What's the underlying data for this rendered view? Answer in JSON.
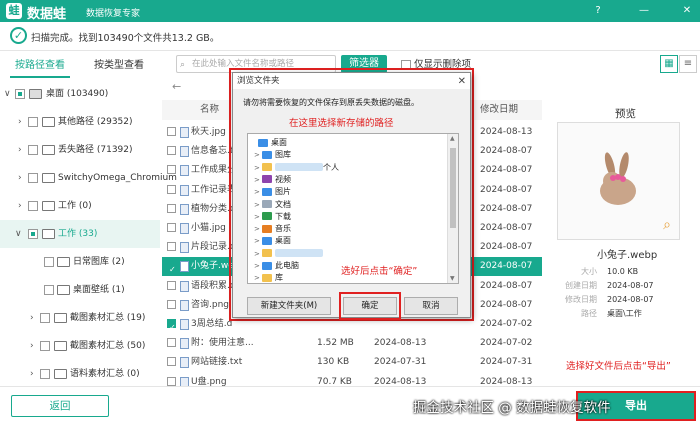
{
  "app": {
    "name": "数据蛙",
    "subtitle": "数据恢复专家",
    "brand_color": "#18a98e",
    "window_controls": [
      "?",
      "—",
      "✕"
    ]
  },
  "scan": {
    "status_text": "扫描完成。找到103490个文件共13.2 GB。"
  },
  "tabs": [
    {
      "label": "按路径查看",
      "active": true
    },
    {
      "label": "按类型查看",
      "active": false
    }
  ],
  "search": {
    "placeholder": "在此处输入文件名称或路径"
  },
  "filter_button": "筛选器",
  "only_deleted": "仅显示删除项",
  "tree": [
    {
      "label": "桌面 (103490)",
      "checkbox": "partial",
      "expanded": true
    },
    {
      "label": "其他路径 (29352)",
      "checkbox": "off"
    },
    {
      "label": "丢失路径 (71392)",
      "checkbox": "off"
    },
    {
      "label": "SwitchyOmega_Chromium",
      "checkbox": "off"
    },
    {
      "label": "工作 (0)",
      "checkbox": "off"
    },
    {
      "label": "工作 (33)",
      "checkbox": "partial",
      "expanded": true,
      "selected": true
    },
    {
      "label": "日常图库 (2)",
      "checkbox": "off"
    },
    {
      "label": "桌面壁纸 (1)",
      "checkbox": "off"
    },
    {
      "label": "截图素材汇总 (19)",
      "checkbox": "off"
    },
    {
      "label": "截图素材汇总 (50)",
      "checkbox": "off"
    },
    {
      "label": "语料素材汇总 (0)",
      "checkbox": "off"
    }
  ],
  "list": {
    "headers": {
      "name": "名称",
      "modified": "修改日期"
    },
    "rows": [
      {
        "name": "秋天.jpg",
        "size": "",
        "created": "",
        "modified": "2024-08-13",
        "checked": false,
        "selected": false
      },
      {
        "name": "信息备忘.t",
        "size": "",
        "created": "",
        "modified": "2024-08-07",
        "checked": false,
        "selected": false
      },
      {
        "name": "工作成果分",
        "size": "",
        "created": "",
        "modified": "2024-08-07",
        "checked": false,
        "selected": false
      },
      {
        "name": "工作记录表",
        "size": "",
        "created": "",
        "modified": "2024-08-07",
        "checked": false,
        "selected": false
      },
      {
        "name": "植物分类.d",
        "size": "",
        "created": "",
        "modified": "2024-08-07",
        "checked": false,
        "selected": false
      },
      {
        "name": "小猫.jpg",
        "size": "",
        "created": "",
        "modified": "2024-08-07",
        "checked": false,
        "selected": false
      },
      {
        "name": "片段记录.d",
        "size": "",
        "created": "",
        "modified": "2024-08-07",
        "checked": false,
        "selected": false
      },
      {
        "name": "小兔子.we",
        "size": "",
        "created": "",
        "modified": "2024-08-07",
        "checked": true,
        "selected": true
      },
      {
        "name": "语段积累.d",
        "size": "",
        "created": "",
        "modified": "2024-08-07",
        "checked": false,
        "selected": false
      },
      {
        "name": "咨询.png",
        "size": "",
        "created": "",
        "modified": "2024-08-07",
        "checked": false,
        "selected": false
      },
      {
        "name": "3周总结.d",
        "size": "",
        "created": "",
        "modified": "2024-07-02",
        "checked": true,
        "selected": false
      },
      {
        "name": "附：使用注意...",
        "size": "1.52 MB",
        "created": "2024-08-13",
        "modified": "2024-07-02",
        "checked": false,
        "selected": false
      },
      {
        "name": "网站链接.txt",
        "size": "130 KB",
        "created": "2024-07-31",
        "modified": "2024-07-31",
        "checked": false,
        "selected": false
      },
      {
        "name": "U盘.png",
        "size": "70.7 KB",
        "created": "2024-08-13",
        "modified": "2024-08-13",
        "checked": false,
        "selected": false
      }
    ]
  },
  "preview": {
    "title": "预览",
    "file_name": "小兔子.webp",
    "meta": [
      {
        "key": "大小",
        "value": "10.0 KB"
      },
      {
        "key": "创建日期",
        "value": "2024-08-07"
      },
      {
        "key": "修改日期",
        "value": "2024-08-07"
      },
      {
        "key": "路径",
        "value": "桌面\\工作"
      }
    ]
  },
  "dialog": {
    "title": "浏览文件夹",
    "prompt": "请勿将需要恢复的文件保存到原丢失数据的磁盘。",
    "annotation_top": "在这里选择新存储的路径",
    "annotation_tree": "选好后点击“确定”",
    "nodes": [
      {
        "label": "桌面",
        "icon_color": "#3a8ee6",
        "depth": 0,
        "chevron": ""
      },
      {
        "label": "图库",
        "icon_color": "#3a8ee6",
        "depth": 1,
        "chevron": ">"
      },
      {
        "label": "个人",
        "icon_color": "#f2c14e",
        "depth": 1,
        "chevron": ">",
        "blurred": true
      },
      {
        "label": "视频",
        "icon_color": "#8e44ad",
        "depth": 1,
        "chevron": ">"
      },
      {
        "label": "图片",
        "icon_color": "#3a8ee6",
        "depth": 1,
        "chevron": ">"
      },
      {
        "label": "文档",
        "icon_color": "#9aa8b8",
        "depth": 1,
        "chevron": ">"
      },
      {
        "label": "下载",
        "icon_color": "#2d9b4e",
        "depth": 1,
        "chevron": ">"
      },
      {
        "label": "音乐",
        "icon_color": "#e67e22",
        "depth": 1,
        "chevron": ">"
      },
      {
        "label": "桌面",
        "icon_color": "#3a8ee6",
        "depth": 1,
        "chevron": ">"
      },
      {
        "label": "",
        "icon_color": "#f2c14e",
        "depth": 1,
        "chevron": ">",
        "blurred": true
      },
      {
        "label": "此电脑",
        "icon_color": "#3a8ee6",
        "depth": 1,
        "chevron": ">"
      },
      {
        "label": "库",
        "icon_color": "#f2c14e",
        "depth": 1,
        "chevron": ">"
      }
    ],
    "new_folder": "新建文件夹(M)",
    "ok": "确定",
    "cancel": "取消"
  },
  "footer": {
    "back": "返回",
    "export": "导出",
    "annotation": "选择好文件后点击“导出”",
    "watermark": "掘金技术社区 @ 数据蛙恢复软件"
  },
  "annotation_color": "#e02020"
}
